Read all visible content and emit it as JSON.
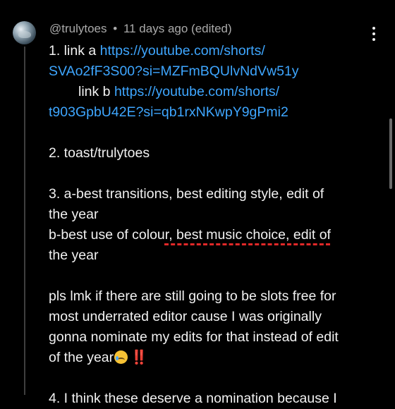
{
  "comment": {
    "username": "@trulytoes",
    "separator": "•",
    "timestamp": "11 days ago (edited)",
    "menu_icon": "more-vert-icon",
    "lines": {
      "l1_prefix": "1. link a ",
      "l1_link": "https://youtube.com/shorts/",
      "l2_link": "SVAo2fF3S00?si=MZFmBQUlvNdVw51y",
      "l3_prefix": "link b ",
      "l3_link": "https://youtube.com/shorts/",
      "l4_link": "t903GpbU42E?si=qb1rxNKwpY9gPmi2",
      "l5": "2. toast/trulytoes",
      "l6": "3. a-best transitions, best editing style, edit of",
      "l7": "the year",
      "l8_prefix": " b-best use of colou",
      "l8_spell": "r, best music choice, edit of",
      "l9": "the year",
      "l10": "pls lmk if there are still going to be slots free for",
      "l11": "most underrated editor cause I was originally",
      "l12": "gonna nominate my edits for that instead of edit",
      "l13": "of the year",
      "l13_emoji_1": "crying-face-emoji",
      "l13_emoji_2": "‼️",
      "l14": "4. I think these deserve a nomination because I"
    }
  }
}
